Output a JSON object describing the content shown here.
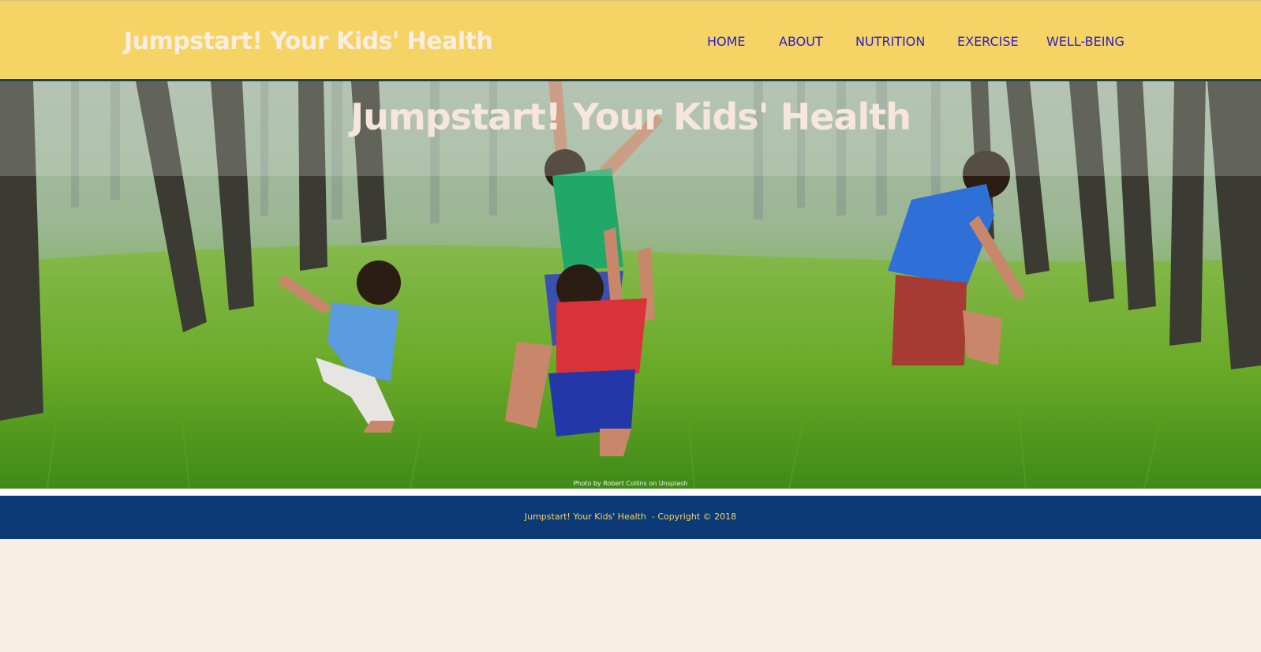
{
  "header": {
    "site_title": "Jumpstart! Your Kids' Health",
    "nav": [
      {
        "label": "HOME"
      },
      {
        "label": "ABOUT"
      },
      {
        "label": "NUTRITION"
      },
      {
        "label": "EXERCISE"
      },
      {
        "label": "WELL-BEING"
      }
    ]
  },
  "hero": {
    "title": "Jumpstart! Your Kids' Health",
    "photo_credit": "Photo by Robert Collins on Unsplash"
  },
  "footer": {
    "text": "Jumpstart! Your Kids' Health  - Copyright © 2018"
  },
  "colors": {
    "header_bg": "#f5d465",
    "nav_link": "#2a21c9",
    "footer_bg": "#0b3a76",
    "footer_text": "#f5d465",
    "page_bg": "#f8efe4"
  }
}
